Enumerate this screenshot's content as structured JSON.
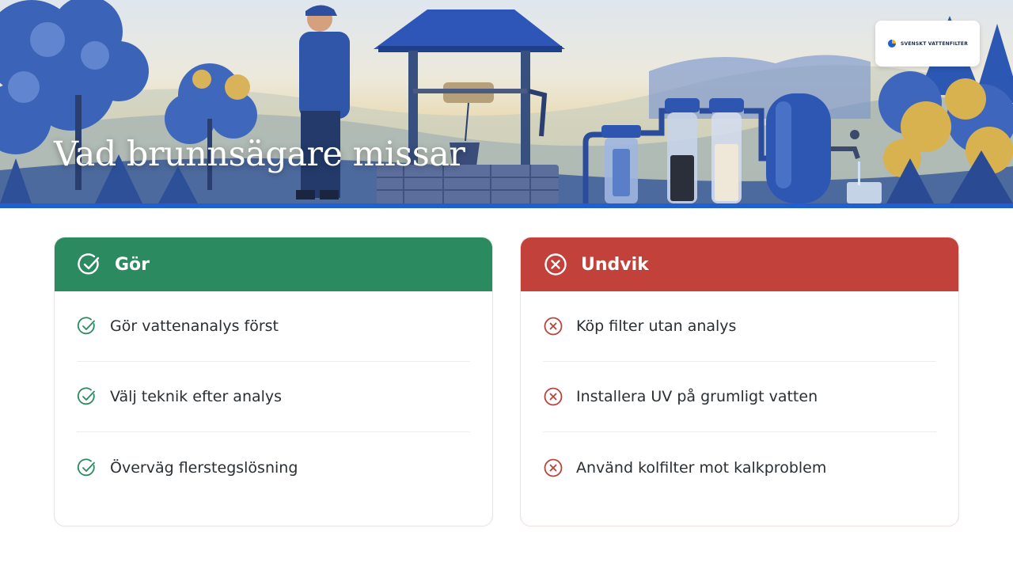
{
  "hero": {
    "title": "Vad brunnsägare missar",
    "logo_text": "SVENSKT VATTENFILTER"
  },
  "do_card": {
    "title": "Gör",
    "icon": "check-circle-icon",
    "color": "#2b8a5f",
    "items": [
      {
        "text": "Gör vattenanalys först"
      },
      {
        "text": "Välj teknik efter analys"
      },
      {
        "text": "Överväg flerstegslösning"
      }
    ]
  },
  "avoid_card": {
    "title": "Undvik",
    "icon": "x-circle-icon",
    "color": "#c2413a",
    "items": [
      {
        "text": "Köp filter utan analys"
      },
      {
        "text": "Installera UV på grumligt vatten"
      },
      {
        "text": "Använd kolfilter mot kalkproblem"
      }
    ]
  },
  "colors": {
    "accent_bar": "#1f5fd1",
    "check": "#2b8a5f",
    "cross": "#b8443c"
  }
}
